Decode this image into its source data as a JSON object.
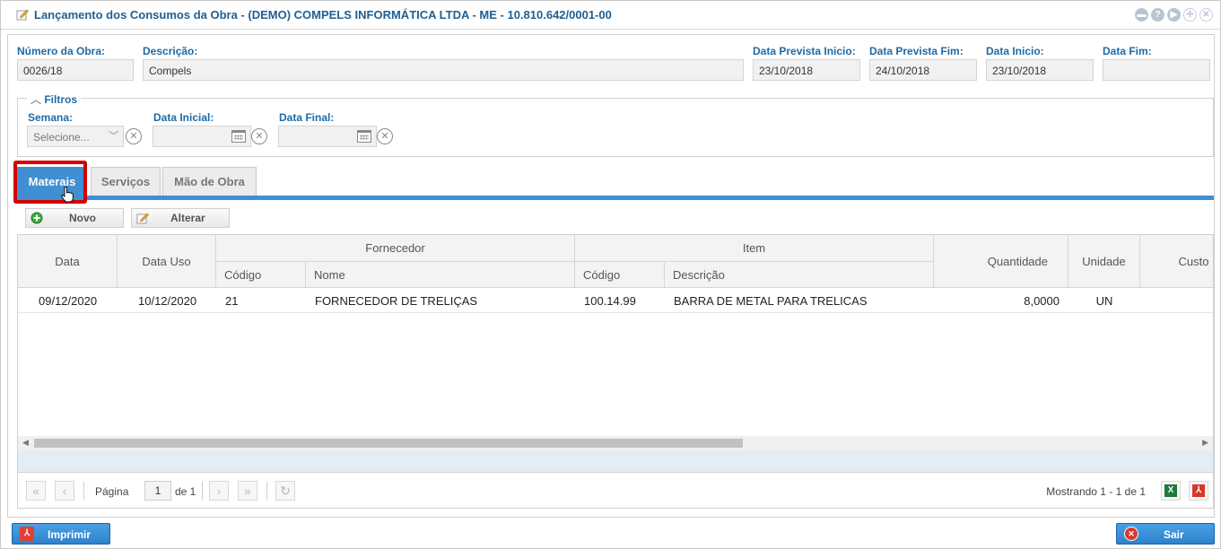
{
  "window": {
    "title": "Lançamento dos Consumos da Obra - (DEMO) COMPELS INFORMÁTICA LTDA - ME - 10.810.642/0001-00",
    "controls": [
      "minimize-icon",
      "help-icon",
      "next-icon",
      "expand-icon",
      "close-icon"
    ]
  },
  "header_fields": {
    "numero_obra": {
      "label": "Número da Obra:",
      "value": "0026/18"
    },
    "descricao": {
      "label": "Descrição:",
      "value": "Compels"
    },
    "data_prevista_inicio": {
      "label": "Data Prevista Inicio:",
      "value": "23/10/2018"
    },
    "data_prevista_fim": {
      "label": "Data Prevista Fim:",
      "value": "24/10/2018"
    },
    "data_inicio": {
      "label": "Data Inicio:",
      "value": "23/10/2018"
    },
    "data_fim": {
      "label": "Data Fim:",
      "value": ""
    }
  },
  "filters": {
    "legend": "Filtros",
    "semana": {
      "label": "Semana:",
      "placeholder": "Selecione..."
    },
    "data_inicial": {
      "label": "Data Inicial:",
      "value": ""
    },
    "data_final": {
      "label": "Data Final:",
      "value": ""
    }
  },
  "tabs": [
    {
      "label": "Materais",
      "active": true
    },
    {
      "label": "Serviços",
      "active": false
    },
    {
      "label": "Mão de Obra",
      "active": false
    }
  ],
  "toolbar": {
    "novo_label": "Novo",
    "alterar_label": "Alterar"
  },
  "grid": {
    "headers": {
      "data": "Data",
      "data_uso": "Data Uso",
      "fornecedor": "Fornecedor",
      "fornecedor_codigo": "Código",
      "fornecedor_nome": "Nome",
      "item": "Item",
      "item_codigo": "Código",
      "item_descricao": "Descrição",
      "quantidade": "Quantidade",
      "unidade": "Unidade",
      "custo": "Custo"
    },
    "rows": [
      {
        "data": "09/12/2020",
        "data_uso": "10/12/2020",
        "fornecedor_codigo": "21",
        "fornecedor_nome": "FORNECEDOR DE TRELIÇAS",
        "item_codigo": "100.14.99",
        "item_descricao": "BARRA DE METAL PARA TRELICAS",
        "quantidade": "8,0000",
        "unidade": "UN"
      }
    ]
  },
  "pager": {
    "page_label": "Página",
    "page_value": "1",
    "of_label": "de 1",
    "showing": "Mostrando 1 - 1 de 1"
  },
  "footer": {
    "imprimir_label": "Imprimir",
    "sair_label": "Sair"
  },
  "colors": {
    "accent": "#3f8fd2",
    "title": "#1f5f94",
    "highlight": "#d40000"
  }
}
